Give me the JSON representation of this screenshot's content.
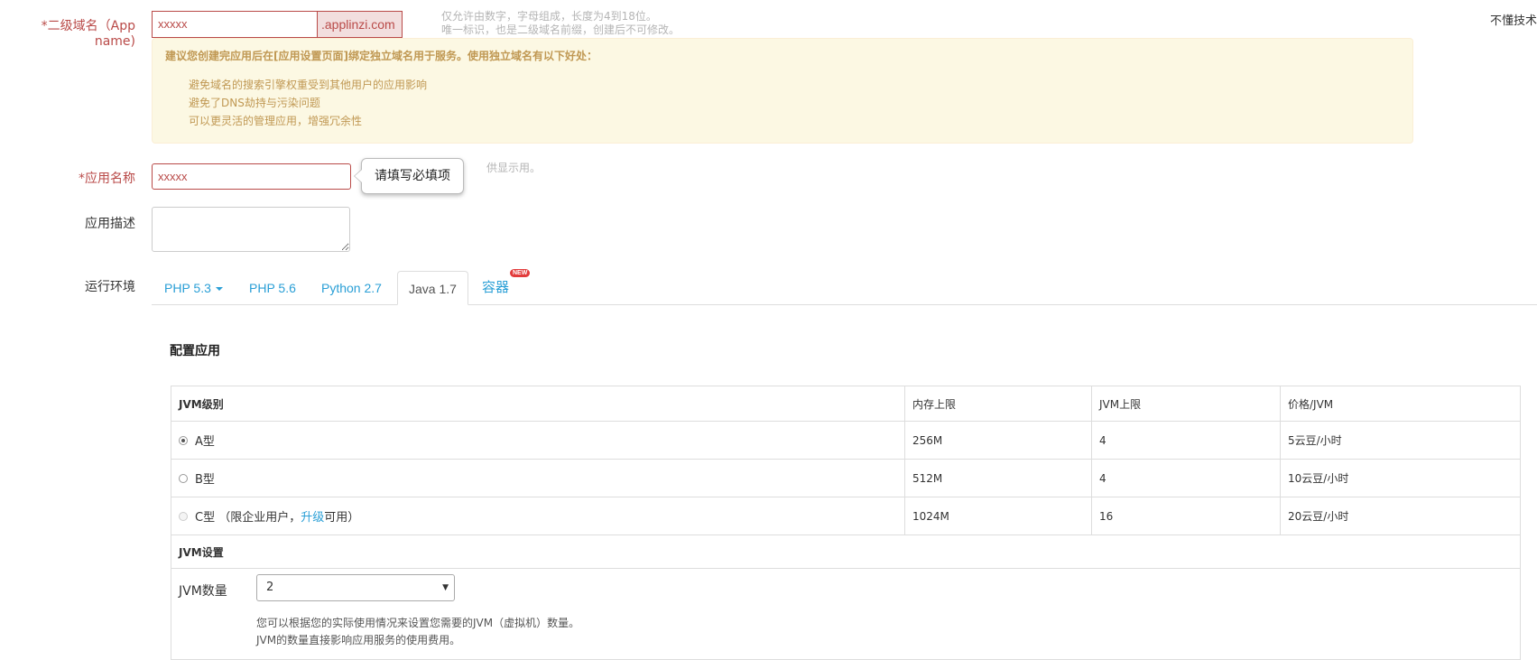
{
  "top_right_link": "不懂技术",
  "app_domain": {
    "label": "*二级域名（App name)",
    "value": "xxxxx",
    "suffix": ".applinzi.com",
    "hint_line1": "仅允许由数字，字母组成，长度为4到18位。",
    "hint_line2": "唯一标识，也是二级域名前缀，创建后不可修改。"
  },
  "alert": {
    "title": "建议您创建完应用后在[应用设置页面]绑定独立域名用于服务。使用独立域名有以下好处：",
    "items": [
      "避免域名的搜索引擎权重受到其他用户的应用影响",
      "避免了DNS劫持与污染问题",
      "可以更灵活的管理应用，增强冗余性"
    ]
  },
  "app_name": {
    "label": "*应用名称",
    "value": "xxxxx",
    "tooltip": "请填写必填项",
    "hint": "供显示用。"
  },
  "app_desc": {
    "label": "应用描述",
    "value": ""
  },
  "runtime": {
    "label": "运行环境",
    "tabs": [
      "PHP 5.3",
      "PHP 5.6",
      "Python 2.7",
      "Java 1.7",
      "容器"
    ],
    "active_tab": "Java 1.7",
    "new_badge": "NEW"
  },
  "config": {
    "title": "配置应用",
    "columns": [
      "JVM级别",
      "内存上限",
      "JVM上限",
      "价格/JVM"
    ],
    "rows": [
      {
        "name": "A型",
        "memory": "256M",
        "jvm": "4",
        "price": "5云豆/小时",
        "selected": true,
        "disabled": false
      },
      {
        "name": "B型",
        "memory": "512M",
        "jvm": "4",
        "price": "10云豆/小时",
        "selected": false,
        "disabled": false
      },
      {
        "name_prefix": "C型 （限企业用户，",
        "name_link": "升级",
        "name_suffix": "可用）",
        "memory": "1024M",
        "jvm": "16",
        "price": "20云豆/小时",
        "selected": false,
        "disabled": true
      }
    ],
    "jvm_settings_title": "JVM设置",
    "jvm_count_label": "JVM数量",
    "jvm_count_value": "2",
    "note_line1": "您可以根据您的实际使用情况来设置您需要的JVM（虚拟机）数量。",
    "note_line2": "JVM的数量直接影响应用服务的使用费用。"
  },
  "colors": {
    "error": "#b94a48",
    "error_bg": "#f2dede",
    "link": "#2a9fd6",
    "warning_text": "#c09853",
    "warning_bg": "#fcf8e3"
  }
}
